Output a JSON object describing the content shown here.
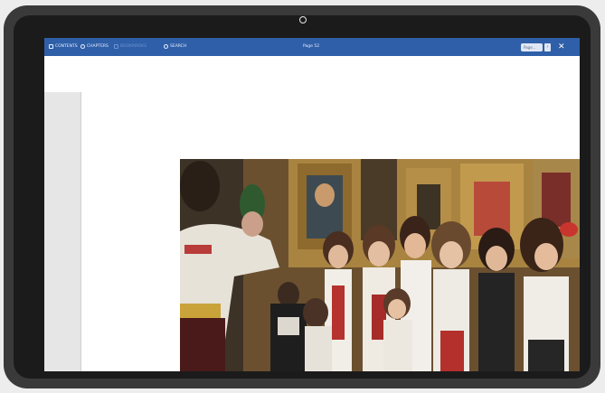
{
  "toolbar": {
    "items": [
      {
        "label": "CONTENTS",
        "icon": "contents-icon"
      },
      {
        "label": "CHAPTERS",
        "icon": "chapters-icon"
      },
      {
        "label": "BOOKMARKS",
        "icon": "bookmark-icon"
      },
      {
        "label": "SEARCH",
        "icon": "search-icon"
      }
    ],
    "title": "Page 52",
    "page_input_placeholder": "Page...",
    "next_label": "›",
    "close_label": "✕"
  },
  "colors": {
    "toolbar_bg": "#2f5fa8",
    "device_frame": "#3a3a3a",
    "screen_bg": "#ffffff"
  },
  "photo": {
    "description_icon": "choir-photo"
  }
}
